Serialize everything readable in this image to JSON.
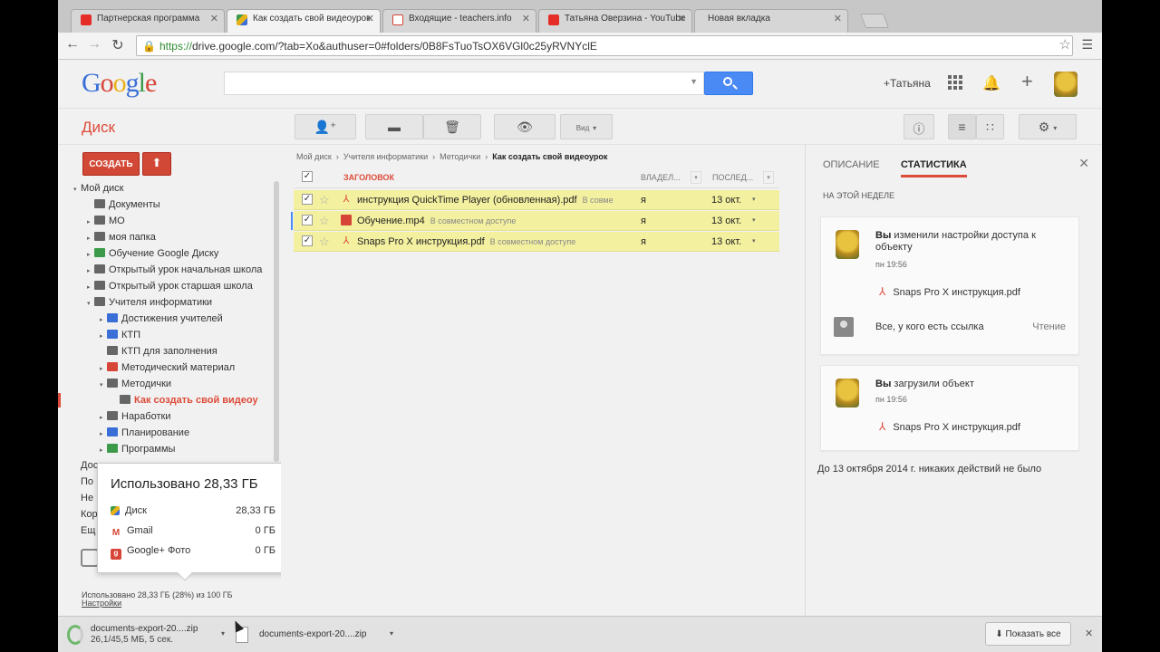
{
  "colors": {
    "accent": "#dd4b39",
    "search_button": "#4a8af4",
    "selected_row": "#f3f0a0"
  },
  "browser": {
    "tabs": [
      {
        "title": "Партнерская программа",
        "favicon": "youtube-icon",
        "color": "#e52d27"
      },
      {
        "title": "Как создать свой видеоурок",
        "favicon": "drive-icon",
        "color": "#3d9a4a"
      },
      {
        "title": "Входящие - teachers.info",
        "favicon": "gmail-icon",
        "color": "#d64537"
      },
      {
        "title": "Татьяна Оверзина - YouTube",
        "favicon": "youtube-icon",
        "color": "#e52d27"
      },
      {
        "title": "Новая вкладка",
        "favicon": "",
        "color": ""
      }
    ],
    "url_https": "https://",
    "url_rest": "drive.google.com/?tab=Xo&authuser=0#folders/0B8FsTuoTsOX6VGl0c25yRVNYclE"
  },
  "header": {
    "logo": [
      "G",
      "o",
      "o",
      "g",
      "l",
      "e"
    ],
    "user_name": "+Татьяна"
  },
  "toolbar": {
    "title": "Диск",
    "view_label": "Вид"
  },
  "nav": {
    "create_label": "СОЗДАТЬ",
    "items": [
      {
        "label": "Мой диск",
        "arrow": "▾",
        "level": 0,
        "icon": ""
      },
      {
        "label": "Документы",
        "arrow": "",
        "level": 1,
        "icon": "#666666"
      },
      {
        "label": "МО",
        "arrow": "▸",
        "level": 1,
        "icon": "#666666"
      },
      {
        "label": "моя папка",
        "arrow": "▸",
        "level": 1,
        "icon": "#666666"
      },
      {
        "label": "Обучение Google Диску",
        "arrow": "▸",
        "level": 1,
        "icon": "#3d9a4a"
      },
      {
        "label": "Открытый урок начальная школа",
        "arrow": "▸",
        "level": 1,
        "icon": "#666666"
      },
      {
        "label": "Открытый урок старшая школа",
        "arrow": "▸",
        "level": 1,
        "icon": "#666666"
      },
      {
        "label": "Учителя информатики",
        "arrow": "▾",
        "level": 1,
        "icon": "#666666"
      },
      {
        "label": "Достижения учителей",
        "arrow": "▸",
        "level": 2,
        "icon": "#3a6fd8"
      },
      {
        "label": "КТП",
        "arrow": "▸",
        "level": 2,
        "icon": "#3a6fd8"
      },
      {
        "label": "КТП для заполнения",
        "arrow": "",
        "level": 2,
        "icon": "#666666"
      },
      {
        "label": "Методический материал",
        "arrow": "▸",
        "level": 2,
        "icon": "#d64537"
      },
      {
        "label": "Методички",
        "arrow": "▾",
        "level": 2,
        "icon": "#666666"
      },
      {
        "label": "Как создать свой видеоу",
        "arrow": "",
        "level": 3,
        "icon": "#666666",
        "selected": true
      },
      {
        "label": "Наработки",
        "arrow": "▸",
        "level": 2,
        "icon": "#666666"
      },
      {
        "label": "Планирование",
        "arrow": "▸",
        "level": 2,
        "icon": "#3a6fd8"
      },
      {
        "label": "Программы",
        "arrow": "▸",
        "level": 2,
        "icon": "#3d9a4a"
      }
    ],
    "stubs": [
      "Дос",
      "По",
      "Не",
      "Кор",
      "Ещ"
    ],
    "quota_text": "Использовано 28,33 ГБ (28%) из 100 ГБ",
    "settings_label": "Настройки"
  },
  "storage_popup": {
    "title": "Использовано 28,33 ГБ",
    "rows": [
      {
        "icon": "drive-icon",
        "label": "Диск",
        "value": "28,33 ГБ",
        "color": "#3d9a4a"
      },
      {
        "icon": "gmail-icon",
        "label": "Gmail",
        "value": "0 ГБ",
        "color": "#d64537"
      },
      {
        "icon": "google-photos-icon",
        "label": "Google+ Фото",
        "value": "0 ГБ",
        "color": "#d64537"
      }
    ]
  },
  "main": {
    "breadcrumb": [
      "Мой диск",
      "Учителя информатики",
      "Методички",
      "Как создать свой видеоурок"
    ],
    "columns": {
      "title": "ЗАГОЛОВОК",
      "owner": "ВЛАДЕЛ...",
      "modified": "ПОСЛЕД..."
    },
    "files": [
      {
        "name": "инструкция QuickTime Player (обновленная).pdf",
        "shared": "В совме",
        "owner": "я",
        "date": "13 окт.",
        "type": "pdf",
        "checked": true
      },
      {
        "name": "Обучение.mp4",
        "shared": "В совместном доступе",
        "owner": "я",
        "date": "13 окт.",
        "type": "video",
        "checked": true
      },
      {
        "name": "Snaps Pro X инструкция.pdf",
        "shared": "В совместном доступе",
        "owner": "я",
        "date": "13 окт.",
        "type": "pdf",
        "checked": true
      }
    ]
  },
  "panel": {
    "tab_description": "ОПИСАНИЕ",
    "tab_stats": "СТАТИСТИКА",
    "week_label": "НА ЭТОЙ НЕДЕЛЕ",
    "card1": {
      "actor": "Вы",
      "action": "изменили настройки доступа к объекту",
      "time": "пн 19:56",
      "file": "Snaps Pro X инструкция.pdf",
      "link_text": "Все, у кого есть ссылка",
      "permission": "Чтение"
    },
    "card2": {
      "actor": "Вы",
      "action": "загрузили объект",
      "time": "пн 19:56",
      "file": "Snaps Pro X инструкция.pdf"
    },
    "no_activity": "До 13 октября 2014 г. никаких действий не было"
  },
  "downloads": {
    "items": [
      {
        "name": "documents-export-20....zip",
        "status": "26,1/45,5 МБ, 5 сек."
      },
      {
        "name": "documents-export-20....zip",
        "status": ""
      }
    ],
    "show_all": "Показать все"
  }
}
